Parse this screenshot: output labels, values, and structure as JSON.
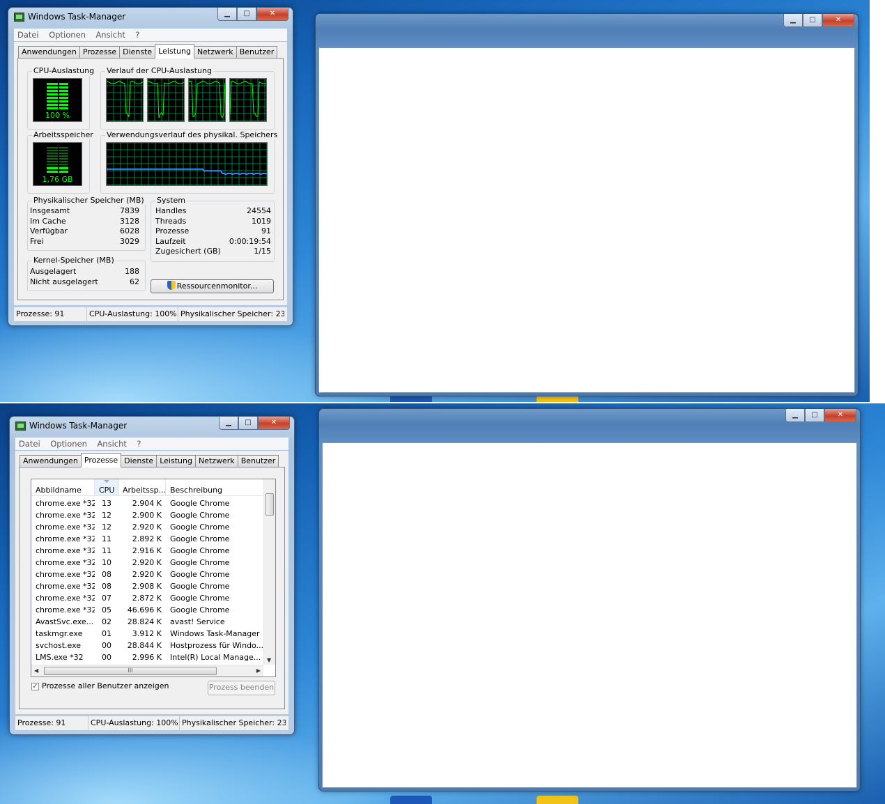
{
  "window": {
    "title": "Windows Task-Manager",
    "minimize": "▁",
    "maximize": "□",
    "close": "✕"
  },
  "menu": [
    "Datei",
    "Optionen",
    "Ansicht",
    "?"
  ],
  "tabs": [
    "Anwendungen",
    "Prozesse",
    "Dienste",
    "Leistung",
    "Netzwerk",
    "Benutzer"
  ],
  "performance": {
    "cpu_usage_label": "CPU-Auslastung",
    "cpu_usage_value": "100 %",
    "cpu_history_label": "Verlauf der CPU-Auslastung",
    "memory_label": "Arbeitsspeicher",
    "memory_value": "1,76 GB",
    "memory_history_label": "Verwendungsverlauf des physikal. Speichers",
    "physical_memory": {
      "label": "Physikalischer Speicher (MB)",
      "rows": [
        {
          "key": "Insgesamt",
          "value": "7839"
        },
        {
          "key": "Im Cache",
          "value": "3128"
        },
        {
          "key": "Verfügbar",
          "value": "6028"
        },
        {
          "key": "Frei",
          "value": "3029"
        }
      ]
    },
    "system": {
      "label": "System",
      "rows": [
        {
          "key": "Handles",
          "value": "24554"
        },
        {
          "key": "Threads",
          "value": "1019"
        },
        {
          "key": "Prozesse",
          "value": "91"
        },
        {
          "key": "Laufzeit",
          "value": "0:00:19:54"
        },
        {
          "key": "Zugesichert (GB)",
          "value": "1/15"
        }
      ]
    },
    "kernel_memory": {
      "label": "Kernel-Speicher (MB)",
      "rows": [
        {
          "key": "Ausgelagert",
          "value": "188"
        },
        {
          "key": "Nicht ausgelagert",
          "value": "62"
        }
      ]
    },
    "resource_monitor_button": "Ressourcenmonitor..."
  },
  "status_top": {
    "processes": "Prozesse: 91",
    "cpu": "CPU-Auslastung: 100%",
    "memory": "Physikalischer Speicher: 23"
  },
  "status_bottom": {
    "processes": "Prozesse: 91",
    "cpu": "CPU-Auslastung: 100%",
    "memory": "Physikalischer Speicher: 23"
  },
  "processes": {
    "columns": [
      "Abbildname",
      "CPU",
      "Arbeitssp...",
      "Beschreibung"
    ],
    "rows": [
      [
        "chrome.exe *32",
        "13",
        "2.904 K",
        "Google Chrome"
      ],
      [
        "chrome.exe *32",
        "12",
        "2.900 K",
        "Google Chrome"
      ],
      [
        "chrome.exe *32",
        "12",
        "2.920 K",
        "Google Chrome"
      ],
      [
        "chrome.exe *32",
        "11",
        "2.892 K",
        "Google Chrome"
      ],
      [
        "chrome.exe *32",
        "11",
        "2.916 K",
        "Google Chrome"
      ],
      [
        "chrome.exe *32",
        "10",
        "2.920 K",
        "Google Chrome"
      ],
      [
        "chrome.exe *32",
        "08",
        "2.920 K",
        "Google Chrome"
      ],
      [
        "chrome.exe *32",
        "08",
        "2.908 K",
        "Google Chrome"
      ],
      [
        "chrome.exe *32",
        "07",
        "2.872 K",
        "Google Chrome"
      ],
      [
        "chrome.exe *32",
        "05",
        "46.696 K",
        "Google Chrome"
      ],
      [
        "AvastSvc.exe...",
        "02",
        "28.824 K",
        "avast! Service"
      ],
      [
        "taskmgr.exe",
        "01",
        "3.912 K",
        "Windows Task-Manager"
      ],
      [
        "svchost.exe",
        "00",
        "28.844 K",
        "Hostprozess für Windo..."
      ],
      [
        "LMS.exe *32",
        "00",
        "2.996 K",
        "Intel(R) Local Manage..."
      ]
    ],
    "show_all_users_label": "Prozesse aller Benutzer anzeigen",
    "show_all_users_checked": true,
    "end_process_button": "Prozess beenden",
    "hscroll_grip": "III"
  },
  "colors": {
    "graph_green": "#00ff00",
    "grid_green": "#008040",
    "memory_line": "#3a8cff"
  }
}
